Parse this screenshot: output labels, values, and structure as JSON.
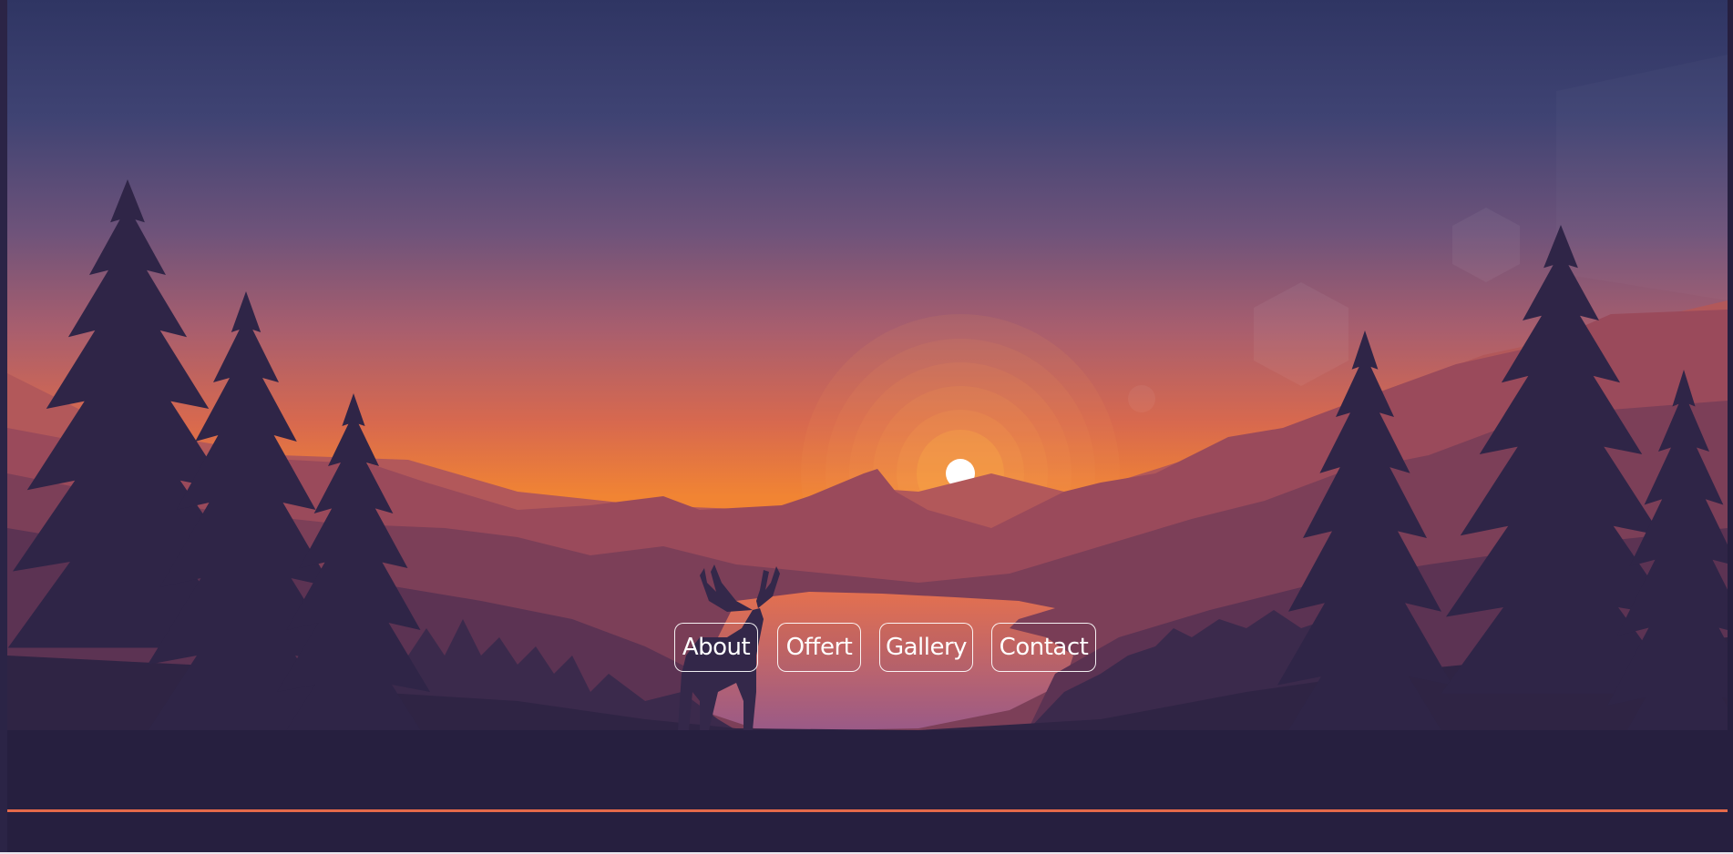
{
  "nav": {
    "items": [
      {
        "label": "About"
      },
      {
        "label": "Offert"
      },
      {
        "label": "Gallery"
      },
      {
        "label": "Contact"
      }
    ]
  },
  "colors": {
    "background": "#261f3f",
    "accent_line": "#e4694a",
    "sky_top": "#2f3563",
    "sky_mid": "#b45c6b",
    "horizon": "#ef7f3b",
    "sun": "#ffffff"
  },
  "icons": {
    "hero": "sunset-forest-deer-illustration"
  }
}
